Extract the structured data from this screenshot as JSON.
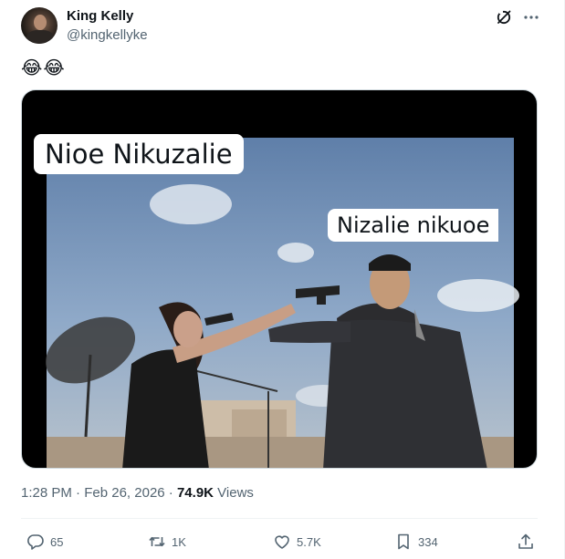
{
  "tweet": {
    "author_name": "King Kelly",
    "author_handle": "@kingkellyke",
    "text": "😂😂",
    "media": {
      "caption_left": "Nioe Nikuzalie",
      "caption_right": "Nizalie nikuoe"
    },
    "time": "1:28 PM",
    "separator": "·",
    "date": "Feb 26, 2026",
    "views_count": "74.9K",
    "views_label": "Views"
  },
  "actions": {
    "replies": "65",
    "retweets": "1K",
    "likes": "5.7K",
    "bookmarks": "334"
  },
  "icons": {
    "header": [
      "grok-icon",
      "more-icon"
    ],
    "actions": [
      "reply-icon",
      "retweet-icon",
      "like-icon",
      "bookmark-icon",
      "share-icon"
    ]
  },
  "colors": {
    "text_primary": "#0f1419",
    "text_secondary": "#536471",
    "divider": "#eff3f4"
  }
}
